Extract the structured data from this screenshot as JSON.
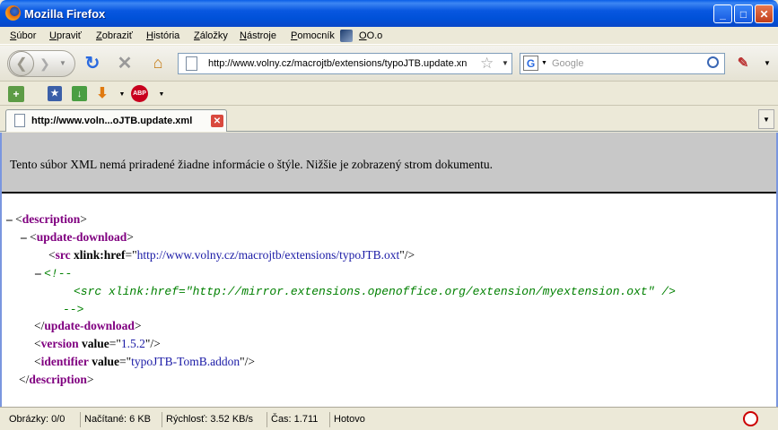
{
  "window": {
    "title": "Mozilla Firefox"
  },
  "menu": [
    {
      "label": "Súbor"
    },
    {
      "label": "Upraviť"
    },
    {
      "label": "Zobraziť"
    },
    {
      "label": "História"
    },
    {
      "label": "Záložky"
    },
    {
      "label": "Nástroje"
    },
    {
      "label": "Pomocník"
    },
    {
      "label": "OO.o"
    }
  ],
  "toolbar": {
    "url": "http://www.volny.cz/macrojtb/extensions/typoJTB.update.xn",
    "search_placeholder": "Google",
    "search_engine_letter": "G"
  },
  "tab": {
    "title": "http://www.voln...oJTB.update.xml"
  },
  "content": {
    "info": "Tento súbor XML nemá priradené žiadne informácie o štýle. Nižšie je zobrazený strom dokumentu.",
    "xml": {
      "description": "description",
      "update_download": "update-download",
      "src": "src",
      "xlink_href": "xlink:href",
      "src_url": "http://www.volny.cz/macrojtb/extensions/typoJTB.oxt",
      "comment_open": "<!--",
      "comment_body": "<src xlink:href=\"http://mirror.extensions.openoffice.org/extension/myextension.oxt\" />",
      "comment_close": "-->",
      "version": "version",
      "value_attr": "value",
      "version_value": "1.5.2",
      "identifier": "identifier",
      "identifier_value": "typoJTB-TomB.addon"
    }
  },
  "status": {
    "images": "Obrázky: 0/0",
    "loaded": "Načítané: 6 KB",
    "speed": "Rýchlosť: 3.52 KB/s",
    "time": "Čas: 1.711",
    "state": "Hotovo"
  },
  "colors": {
    "tag": "#800080",
    "value": "#1a1aa6",
    "comment": "#008000",
    "titlebar": "#0a5ee8"
  }
}
